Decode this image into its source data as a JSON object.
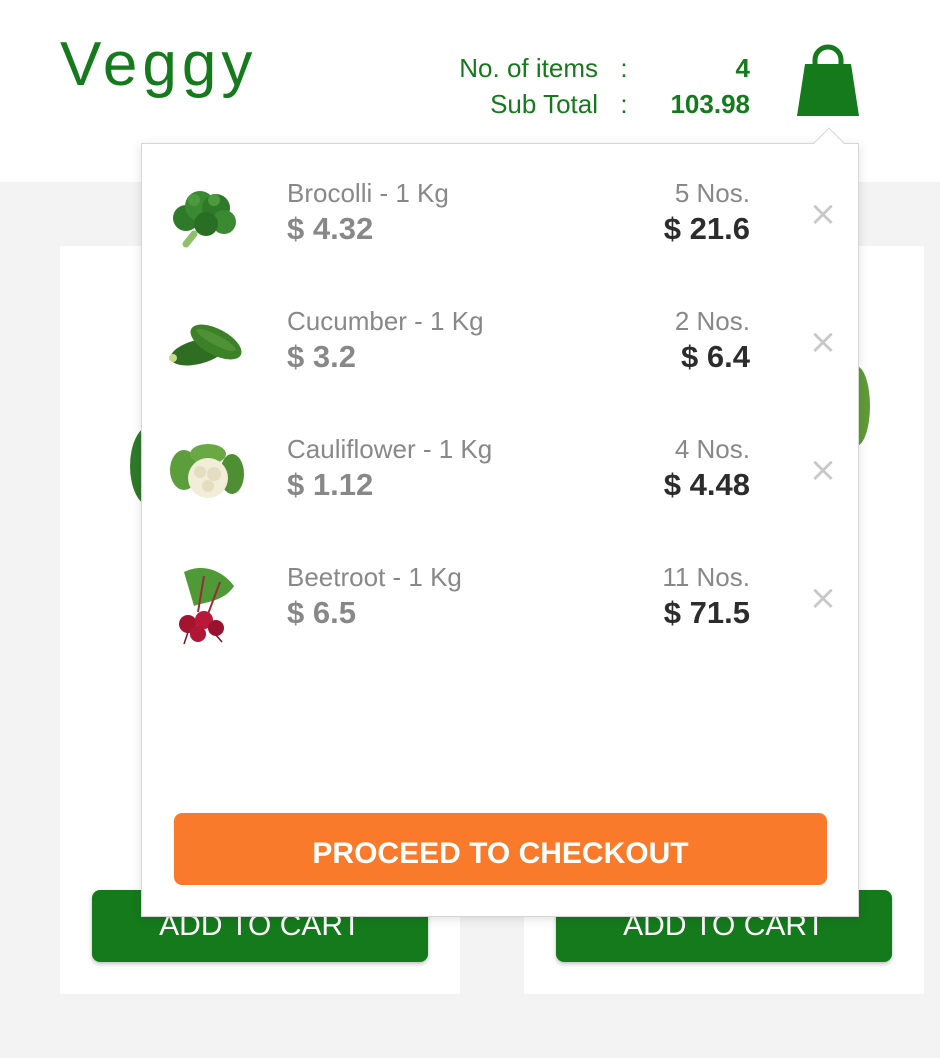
{
  "header": {
    "logo": "Veggy",
    "items_label": "No. of items",
    "items_colon": ":",
    "items_value": "4",
    "subtotal_label": "Sub Total",
    "subtotal_colon": ":",
    "subtotal_value": "103.98"
  },
  "cart": {
    "items": [
      {
        "name": "Brocolli - 1 Kg",
        "price": "$ 4.32",
        "qty": "5 Nos.",
        "total": "$ 21.6",
        "image": "broccoli-image"
      },
      {
        "name": "Cucumber - 1 Kg",
        "price": "$ 3.2",
        "qty": "2 Nos.",
        "total": "$ 6.4",
        "image": "cucumber-image"
      },
      {
        "name": "Cauliflower - 1 Kg",
        "price": "$ 1.12",
        "qty": "4 Nos.",
        "total": "$ 4.48",
        "image": "cauliflower-image"
      },
      {
        "name": "Beetroot - 1 Kg",
        "price": "$ 6.5",
        "qty": "11 Nos.",
        "total": "$ 71.5",
        "image": "beetroot-image"
      }
    ],
    "remove_symbol": "×",
    "checkout_label": "PROCEED TO CHECKOUT"
  },
  "products": {
    "add_to_cart_label": "ADD TO CART"
  },
  "colors": {
    "brand_green": "#157a1c",
    "checkout_orange": "#f97a2a",
    "background": "#f3f3f3"
  }
}
